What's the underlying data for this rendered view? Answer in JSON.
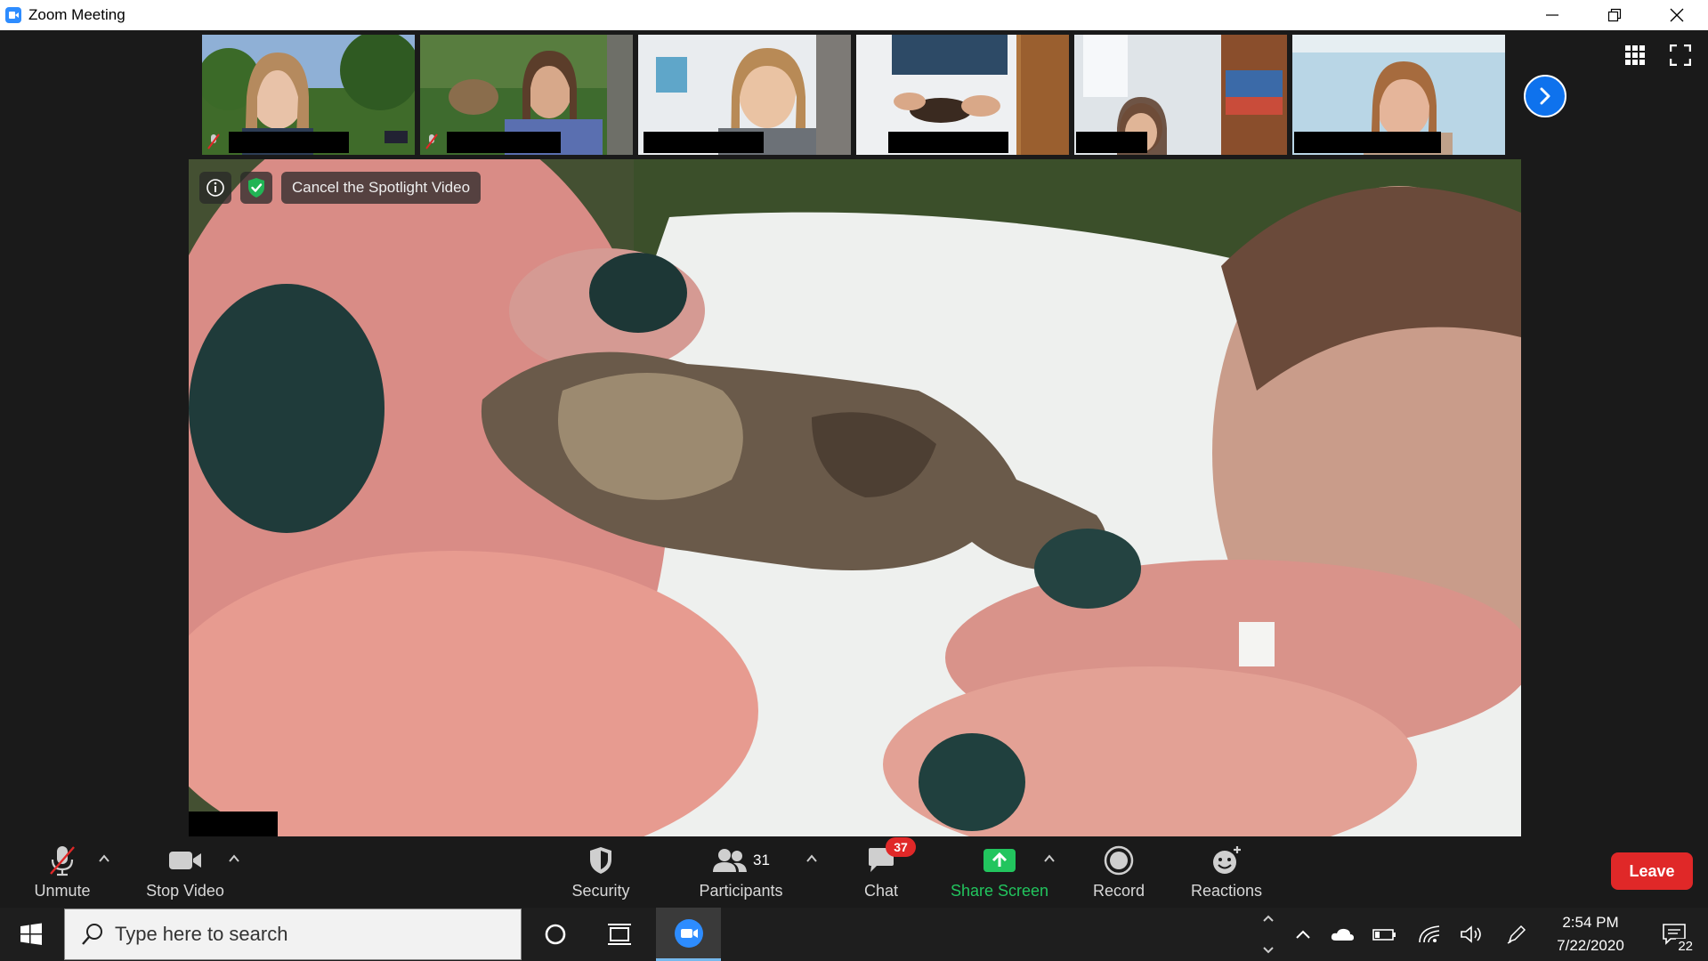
{
  "window": {
    "title": "Zoom Meeting"
  },
  "spotlight": {
    "cancel_label": "Cancel the Spotlight Video"
  },
  "thumbnails": [
    {
      "muted": true
    },
    {
      "muted": true
    },
    {
      "muted": false
    },
    {
      "muted": false
    },
    {
      "muted": false
    },
    {
      "muted": false
    }
  ],
  "toolbar": {
    "unmute_label": "Unmute",
    "stop_video_label": "Stop Video",
    "security_label": "Security",
    "participants_label": "Participants",
    "participants_count": "31",
    "chat_label": "Chat",
    "chat_badge": "37",
    "share_screen_label": "Share Screen",
    "record_label": "Record",
    "reactions_label": "Reactions",
    "leave_label": "Leave"
  },
  "taskbar": {
    "search_placeholder": "Type here to search",
    "time": "2:54 PM",
    "date": "7/22/2020",
    "notification_count": "22"
  },
  "colors": {
    "accent_blue": "#0e72ed",
    "share_green": "#22c55e",
    "leave_red": "#e02828"
  }
}
